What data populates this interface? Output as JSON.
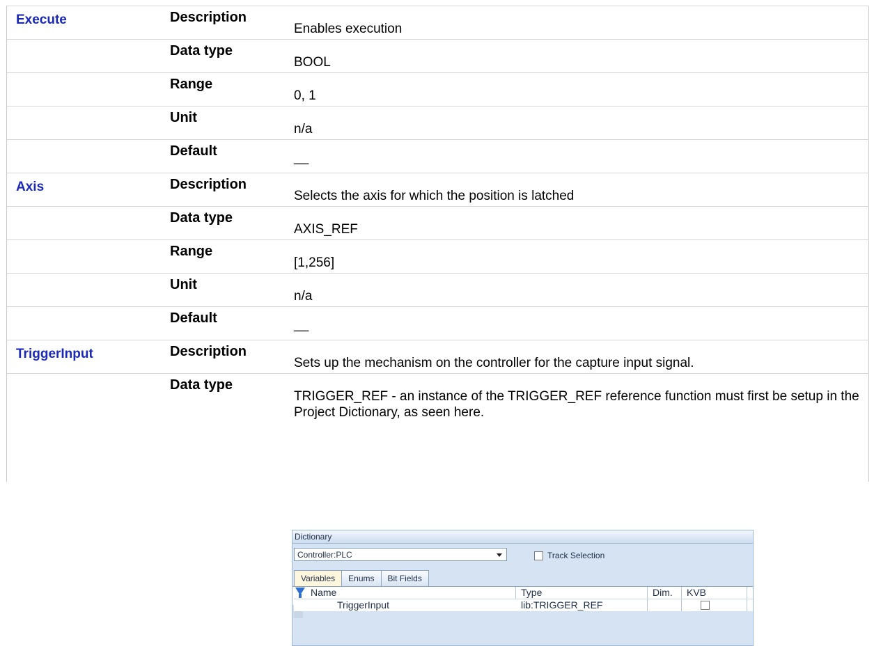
{
  "rows": [
    {
      "param": "Execute",
      "field": "Description",
      "value": "Enables execution"
    },
    {
      "param": "",
      "field": "Data type",
      "value": "BOOL"
    },
    {
      "param": "",
      "field": "Range",
      "value": "0, 1"
    },
    {
      "param": "",
      "field": "Unit",
      "value": "n/a"
    },
    {
      "param": "",
      "field": "Default",
      "value": "__"
    },
    {
      "param": "Axis",
      "field": "Description",
      "value": "Selects the axis for which the position is latched"
    },
    {
      "param": "",
      "field": "Data type",
      "value": "AXIS_REF"
    },
    {
      "param": "",
      "field": "Range",
      "value": "[1,256]"
    },
    {
      "param": "",
      "field": "Unit",
      "value": "n/a"
    },
    {
      "param": "",
      "field": "Default",
      "value": "__"
    },
    {
      "param": "TriggerInput",
      "field": "Description",
      "value": "Sets up the mechanism on the controller for the capture input signal."
    },
    {
      "param": "",
      "field": "Data type",
      "value": "TRIGGER_REF - an instance of the TRIGGER_REF reference function must first be setup in the Project Dictionary, as seen here."
    }
  ],
  "dictionary": {
    "title": "Dictionary",
    "controller_select": "Controller:PLC",
    "track_selection_label": "Track Selection",
    "tabs": [
      "Variables",
      "Enums",
      "Bit Fields"
    ],
    "columns": [
      "Name",
      "Type",
      "Dim.",
      "KVB"
    ],
    "row": {
      "name": "TriggerInput",
      "type": "lib:TRIGGER_REF",
      "dim": "",
      "kvb_checked": false
    }
  }
}
